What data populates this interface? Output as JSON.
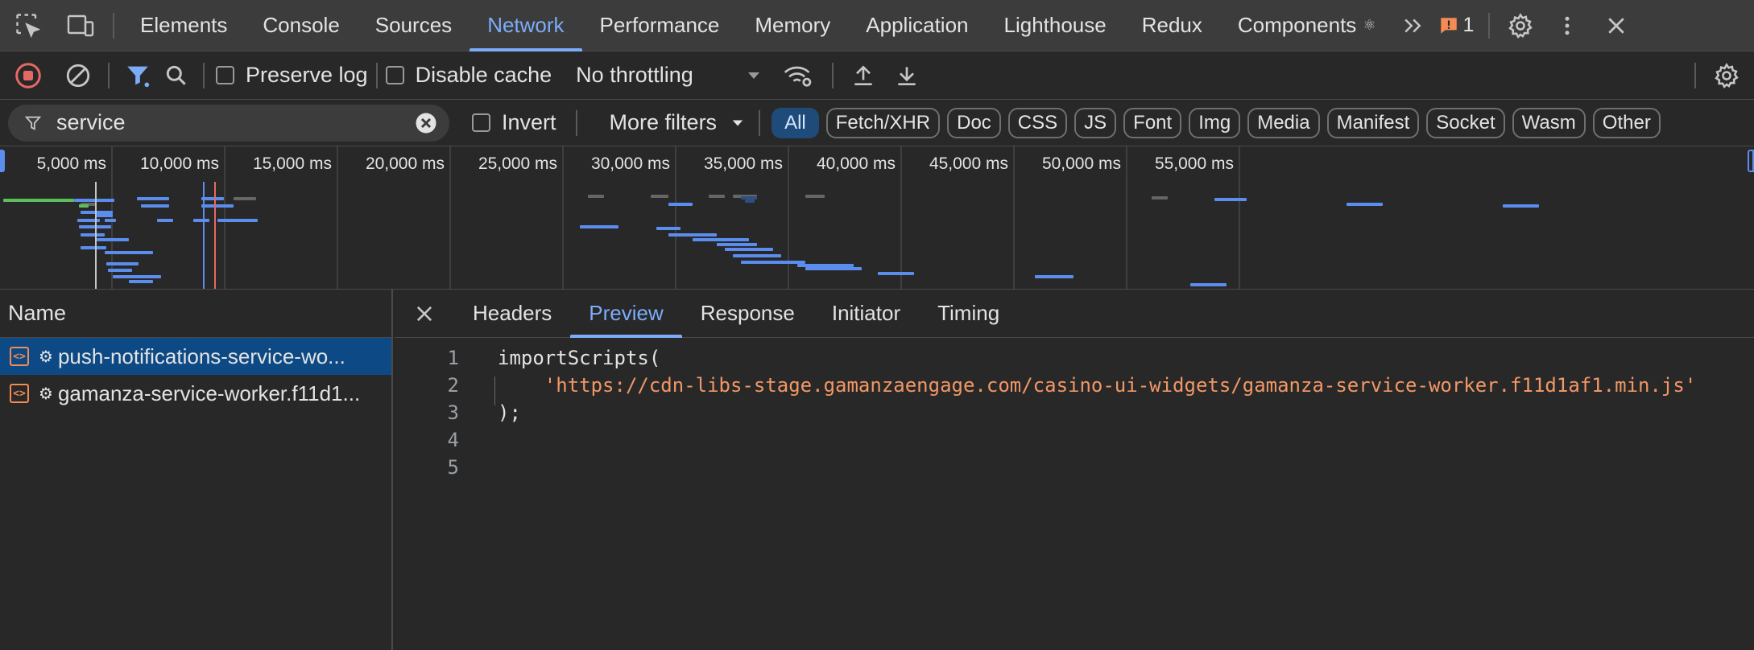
{
  "tabs": [
    "Elements",
    "Console",
    "Sources",
    "Network",
    "Performance",
    "Memory",
    "Application",
    "Lighthouse",
    "Redux",
    "Components"
  ],
  "active_tab": "Network",
  "components_suffix": "⚛",
  "issues_count": "1",
  "toolbar": {
    "preserve_log": "Preserve log",
    "disable_cache": "Disable cache",
    "throttling": "No throttling"
  },
  "filter": {
    "value": "service",
    "invert": "Invert",
    "more_filters": "More filters",
    "types": [
      "All",
      "Fetch/XHR",
      "Doc",
      "CSS",
      "JS",
      "Font",
      "Img",
      "Media",
      "Manifest",
      "Socket",
      "Wasm",
      "Other"
    ]
  },
  "overview": {
    "ticks": [
      "5,000 ms",
      "10,000 ms",
      "15,000 ms",
      "20,000 ms",
      "25,000 ms",
      "30,000 ms",
      "35,000 ms",
      "40,000 ms",
      "45,000 ms",
      "50,000 ms",
      "55,000 ms"
    ]
  },
  "requests": {
    "header": "Name",
    "items": [
      {
        "name": "push-notifications-service-wo..."
      },
      {
        "name": "gamanza-service-worker.f11d1..."
      }
    ]
  },
  "detail": {
    "tabs": [
      "Headers",
      "Preview",
      "Response",
      "Initiator",
      "Timing"
    ],
    "active": "Preview",
    "code": [
      {
        "n": "1",
        "text": "importScripts("
      },
      {
        "n": "2",
        "text": "    'https://cdn-libs-stage.gamanzaengage.com/casino-ui-widgets/gamanza-service-worker.f11d1af1.min.js'"
      },
      {
        "n": "3",
        "text": ");"
      },
      {
        "n": "4",
        "text": ""
      },
      {
        "n": "5",
        "text": ""
      }
    ]
  },
  "colors": {
    "accent": "#7cacf8",
    "record_red": "#e46962",
    "string": "#f29766",
    "waterfall_blue": "#5b8def",
    "waterfall_green": "#5bbf5b"
  }
}
